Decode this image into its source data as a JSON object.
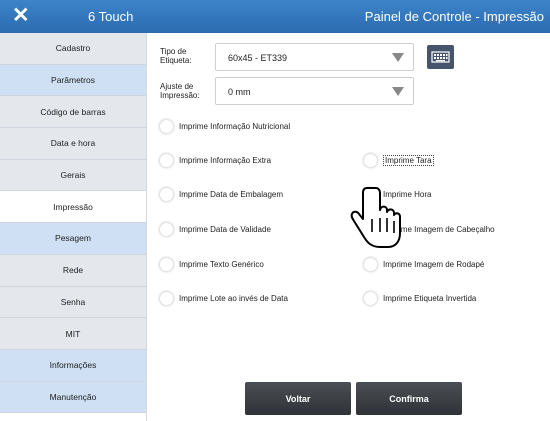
{
  "header": {
    "close_symbol": "✕",
    "app_name": "6 Touch",
    "window_title": "Painel de Controle - Impressão"
  },
  "sidebar": {
    "active_index": 5,
    "items": [
      {
        "label": "Cadastro"
      },
      {
        "label": "Parâmetros"
      },
      {
        "label": "Código de barras"
      },
      {
        "label": "Data e hora"
      },
      {
        "label": "Gerais"
      },
      {
        "label": "Impressão"
      },
      {
        "label": "Pesagem"
      },
      {
        "label": "Rede"
      },
      {
        "label": "Senha"
      },
      {
        "label": "MIT"
      },
      {
        "label": "Informações"
      },
      {
        "label": "Manutenção"
      }
    ]
  },
  "form": {
    "tipo_etiqueta": {
      "label": "Tipo de Etiqueta:",
      "value": "60x45 - ET339"
    },
    "ajuste_impressao": {
      "label": "Ajuste de Impressão:",
      "value": "0 mm"
    }
  },
  "options": {
    "left": [
      "Imprime Informação Nutricional",
      "Imprime Informação Extra",
      "Imprime Data de Embalagem",
      "Imprime Data de Validade",
      "Imprime Texto Genérico",
      "Imprime Lote ao invés de Data"
    ],
    "right": [
      "Imprime Tara",
      "Imprime Hora",
      "Imprime Imagem de Cabeçalho",
      "Imprime Imagem de Rodapé",
      "Imprime Etiqueta Invertida"
    ]
  },
  "buttons": {
    "back": "Voltar",
    "confirm": "Confirma"
  },
  "colors": {
    "titlebar": "#2f70b5",
    "sidebar_blue": "#cfe0f4",
    "sidebar_gray": "#e4e8ed",
    "dark_button": "#3a3d42"
  },
  "icons": {
    "keyboard": "keyboard-icon",
    "cursor": "hand-pointer-icon"
  }
}
